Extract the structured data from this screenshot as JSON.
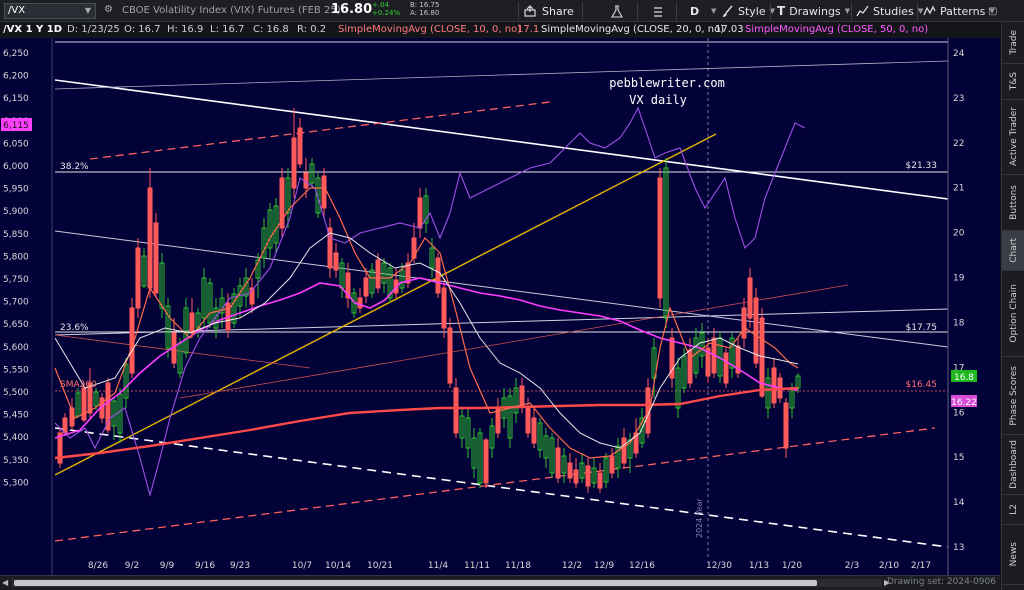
{
  "toolbar": {
    "symbol": "/VX",
    "description": "CBOE Volatility Index (VIX) Futures (FEB 25)",
    "last": "16.80",
    "change": "+.04",
    "change_pct": "+0.24%",
    "bid": "B: 16.75",
    "ask": "A: 16.80",
    "share": "Share",
    "period": "D",
    "style": "Style",
    "drawings": "Drawings",
    "studies": "Studies",
    "patterns": "Patterns"
  },
  "header": {
    "symbol_period": "/VX 1 Y 1D",
    "date": "D: 1/23/25",
    "open": "O: 16.7",
    "high": "H: 16.9",
    "low": "L: 16.7",
    "close": "C: 16.8",
    "range": "R: 0.2",
    "sma10_label": "SimpleMovingAvg (CLOSE, 10, 0, no)",
    "sma10_value": "17.1",
    "sma20_label": "SimpleMovingAvg (CLOSE, 20, 0, no)",
    "sma20_value": "17.03",
    "sma50_label": "SimpleMovingAvg (CLOSE, 50, 0, no)",
    "sma50_value": ""
  },
  "chart": {
    "watermark_line1": "pebblewriter.com",
    "watermark_line2": "VX daily",
    "left_axis": [
      "6,250",
      "6,200",
      "6,150",
      "6,100",
      "6,050",
      "6,000",
      "5,950",
      "5,900",
      "5,850",
      "5,800",
      "5,750",
      "5,700",
      "5,650",
      "5,600",
      "5,550",
      "5,500",
      "5,450",
      "5,400",
      "5,350",
      "5,300"
    ],
    "left_badge": "6,115",
    "right_axis": [
      "24",
      "23",
      "22",
      "21",
      "20",
      "19",
      "18",
      "17",
      "16",
      "15",
      "14",
      "13"
    ],
    "date_axis": [
      "8/26",
      "9/2",
      "9/9",
      "9/16",
      "9/23",
      "10/7",
      "10/14",
      "10/21",
      "11/4",
      "11/11",
      "11/18",
      "12/2",
      "12/9",
      "12/16",
      "12/30",
      "1/13",
      "1/20",
      "2/3",
      "2/10",
      "2/17"
    ],
    "fib_38": "38.2%",
    "fib_23": "23.6%",
    "sma_label": "SMA200",
    "level_2133": "$21.33",
    "level_1775": "$17.75",
    "level_1645": "$16.45",
    "price_badge": "16.8",
    "sma_badge": "16.22",
    "year_marker": "2024 Year",
    "colors": {
      "background": "#020238",
      "up": "#2fbf2f",
      "down": "#ff5a5a",
      "spx": "#a050e6",
      "sma_pink": "#ff3cff",
      "trend_yellow": "#e6b400",
      "trend_red": "#e65050"
    }
  },
  "sidebar": [
    "Trade",
    "T&S",
    "Active Trader",
    "Buttons",
    "Chart",
    "Option Chain",
    "Phase Scores",
    "Dashboard",
    "L2",
    "News"
  ],
  "footer": {
    "drawing_set": "Drawing set: 2024-0906"
  }
}
